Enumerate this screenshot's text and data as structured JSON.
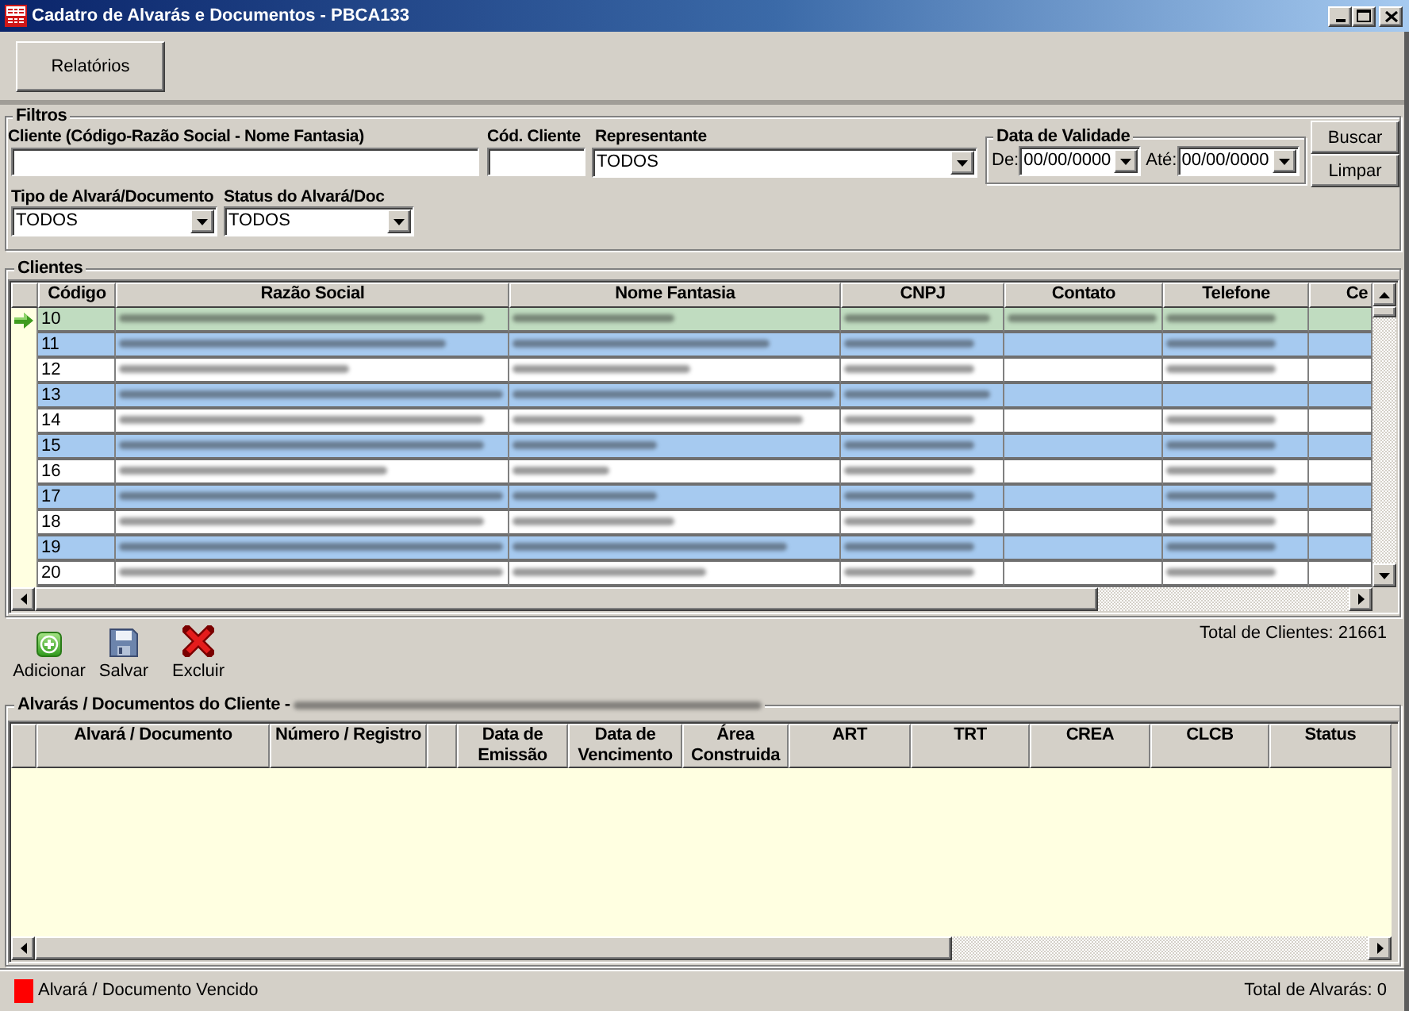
{
  "window": {
    "title": "Cadatro de Alvarás e Documentos - PBCA133"
  },
  "toolbar": {
    "buttons": [
      "Relatórios"
    ]
  },
  "filters": {
    "title": "Filtros",
    "client": {
      "label": "Cliente (Código-Razão Social - Nome Fantasia)"
    },
    "client_code": {
      "label": "Cód. Cliente"
    },
    "representative": {
      "label": "Representante",
      "value": "TODOS"
    },
    "validity": {
      "title": "Data de Validade",
      "from": {
        "label": "De:",
        "value": "00/00/0000"
      },
      "to": {
        "label": "Até:",
        "value": "00/00/0000"
      }
    },
    "buttons": [
      "Buscar",
      "Limpar"
    ],
    "document_type": {
      "label": "Tipo de Alvará/Documento",
      "value": "TODOS"
    },
    "document_status": {
      "label": "Status do Alvará/Doc",
      "value": "TODOS"
    }
  },
  "clients": {
    "title": "Clientes",
    "columns": [
      "Código",
      "Razão Social",
      "Nome Fantasia",
      "CNPJ",
      "Contato",
      "Telefone",
      "Ce"
    ],
    "rows": [
      {
        "code": "10",
        "selected": true
      },
      {
        "code": "11",
        "selected": false
      },
      {
        "code": "12",
        "selected": false
      },
      {
        "code": "13",
        "selected": false
      },
      {
        "code": "14",
        "selected": false
      },
      {
        "code": "15",
        "selected": false
      },
      {
        "code": "16",
        "selected": false
      },
      {
        "code": "17",
        "selected": false
      },
      {
        "code": "18",
        "selected": false
      },
      {
        "code": "19",
        "selected": false
      },
      {
        "code": "20",
        "selected": false
      }
    ]
  },
  "actions": [
    {
      "kind": "add",
      "label": "Adicionar"
    },
    {
      "kind": "save",
      "label": "Salvar"
    },
    {
      "kind": "delete",
      "label": "Excluir"
    }
  ],
  "clients_total": "Total de Clientes: 21661",
  "documents": {
    "title": "Alvarás / Documentos do Cliente -",
    "columns": [
      {
        "kind": "text",
        "label": "Alvará / Documento"
      },
      {
        "kind": "text",
        "label": "Número / Registro"
      },
      {
        "kind": "blank"
      },
      {
        "kind": "text",
        "label": "Data de Emissão"
      },
      {
        "kind": "text",
        "label": "Data de Vencimento"
      },
      {
        "kind": "text",
        "label": "Área Construida"
      },
      {
        "kind": "text",
        "label": "ART"
      },
      {
        "kind": "text",
        "label": "TRT"
      },
      {
        "kind": "text",
        "label": "CREA"
      },
      {
        "kind": "text",
        "label": "CLCB"
      },
      {
        "kind": "text",
        "label": "Status"
      }
    ]
  },
  "status_bar": {
    "legend": "Alvará / Documento Vencido",
    "total": "Total de Alvarás: 0"
  }
}
